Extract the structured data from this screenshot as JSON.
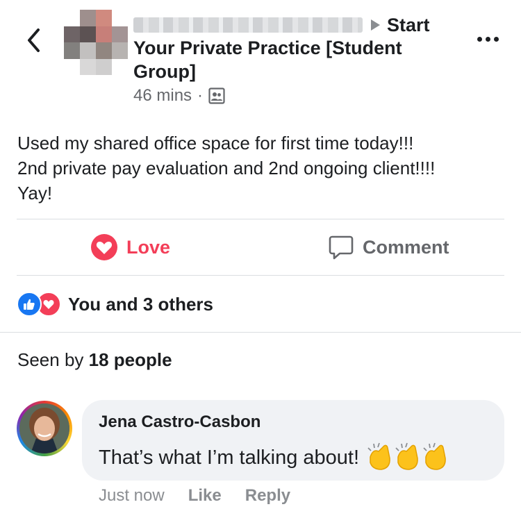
{
  "header": {
    "poster_action": "Start",
    "group_name": "Your Private Practice [Student Group]",
    "time": "46 mins",
    "separator": "·",
    "privacy_icon": "members-group-icon"
  },
  "post": {
    "text": "Used my shared office space for first time today!!!\n2nd private pay evaluation and 2nd ongoing client!!!!\nYay!"
  },
  "actions": {
    "love_label": "Love",
    "comment_label": "Comment"
  },
  "reactions": {
    "summary": "You and 3 others",
    "icons": [
      "like-icon",
      "love-icon"
    ]
  },
  "seen": {
    "prefix": "Seen by",
    "count": "18 people"
  },
  "comment": {
    "author": "Jena Castro-Casbon",
    "text": "That’s what I’m talking about!",
    "emoji": "clapping-hands-icon",
    "time": "Just now",
    "like_label": "Like",
    "reply_label": "Reply"
  },
  "colors": {
    "love": "#f33e58",
    "like_blue": "#1877f2",
    "muted": "#65676b",
    "bubble": "#f0f2f5"
  }
}
